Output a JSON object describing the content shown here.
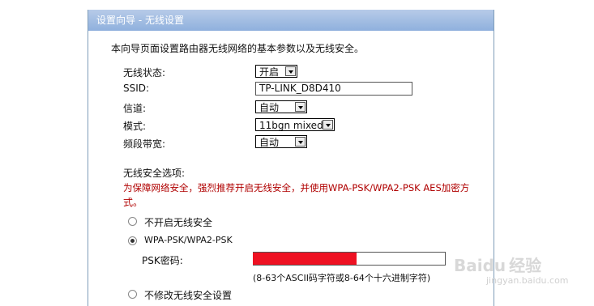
{
  "title": "设置向导 - 无线设置",
  "intro": "本向导页面设置路由器无线网络的基本参数以及无线安全。",
  "fields": {
    "wireless_status": {
      "label": "无线状态:",
      "value": "开启"
    },
    "ssid": {
      "label": "SSID:",
      "value": "TP-LINK_D8D410"
    },
    "channel": {
      "label": "信道:",
      "value": "自动"
    },
    "mode": {
      "label": "模式:",
      "value": "11bgn mixed"
    },
    "bandwidth": {
      "label": "频段带宽:",
      "value": "自动"
    }
  },
  "security": {
    "heading": "无线安全选项:",
    "warning_line1": "为保障网络安全，强烈推荐开启无线安全，并使用WPA-PSK/WPA2-PSK AES加密方",
    "warning_line2": "式。",
    "options": [
      {
        "label": "不开启无线安全",
        "checked": false
      },
      {
        "label": "WPA-PSK/WPA2-PSK",
        "checked": true
      },
      {
        "label": "不修改无线安全设置",
        "checked": false
      }
    ],
    "psk_label": "PSK密码:",
    "psk_hint": "(8-63个ASCII码字符或8-64个十六进制字符)"
  },
  "watermark": {
    "brand": "Baidu",
    "suffix": "经验",
    "url": "jingyan.baidu.com"
  },
  "colors": {
    "titlebar": "#9bb7e0",
    "warning": "#b00000",
    "redaction": "#ee1122"
  }
}
